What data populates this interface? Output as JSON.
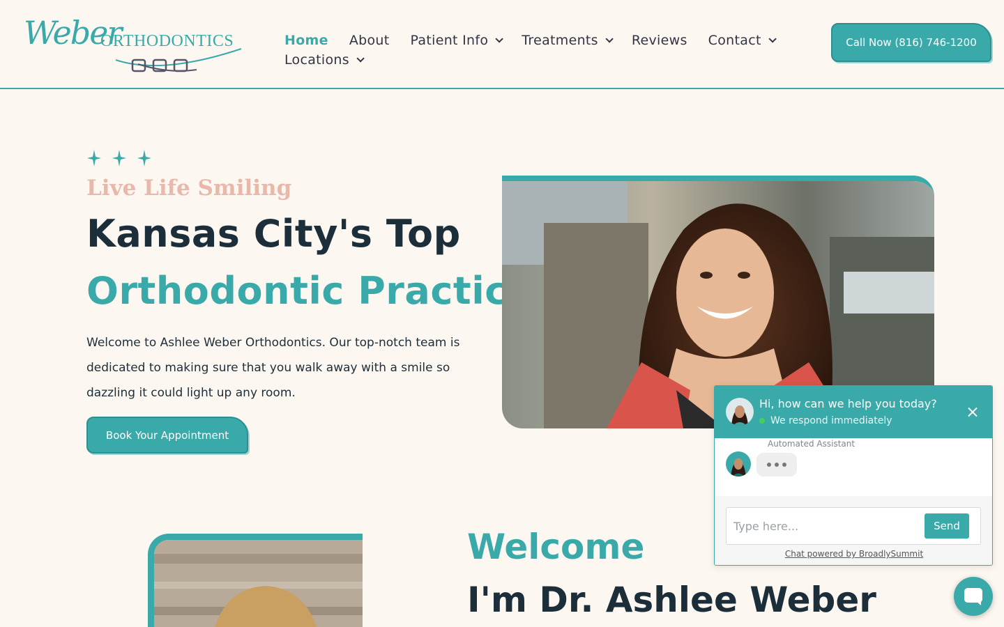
{
  "brand": {
    "logo_script": "Weber",
    "logo_word": "ORTHODONTICS"
  },
  "nav": {
    "items": [
      {
        "label": "Home",
        "active": true,
        "has_dropdown": false
      },
      {
        "label": "About",
        "active": false,
        "has_dropdown": false
      },
      {
        "label": "Patient Info",
        "active": false,
        "has_dropdown": true
      },
      {
        "label": "Treatments",
        "active": false,
        "has_dropdown": true
      },
      {
        "label": "Reviews",
        "active": false,
        "has_dropdown": false
      },
      {
        "label": "Contact",
        "active": false,
        "has_dropdown": true
      },
      {
        "label": "Locations",
        "active": false,
        "has_dropdown": true
      }
    ],
    "call_button": "Call Now (816) 746-1200"
  },
  "hero": {
    "tagline": "Live Life Smiling",
    "heading_line1": "Kansas City's Top",
    "heading_line2": "Orthodontic Practice",
    "intro": "Welcome to Ashlee Weber Orthodontics.  Our top-notch team is dedicated to making sure that you walk away with a smile so dazzling it could light up any room.",
    "cta": "Book Your Appointment"
  },
  "welcome": {
    "heading": "Welcome",
    "name": "I'm Dr. Ashlee Weber"
  },
  "chat": {
    "title": "Hi, how can we help you today?",
    "status": "We respond immediately",
    "assistant_label": "Automated Assistant",
    "input_placeholder": "Type here...",
    "send_label": "Send",
    "powered_by": "Chat powered by BroadlySummit"
  },
  "colors": {
    "accent": "#3aa9a9",
    "dark_text": "#1c2e3a",
    "tagline": "#e8b8aa",
    "background": "#fdf7f2"
  },
  "icons": [
    "sparkle-icon",
    "chevron-down-icon",
    "close-icon",
    "chat-bubble-icon"
  ]
}
